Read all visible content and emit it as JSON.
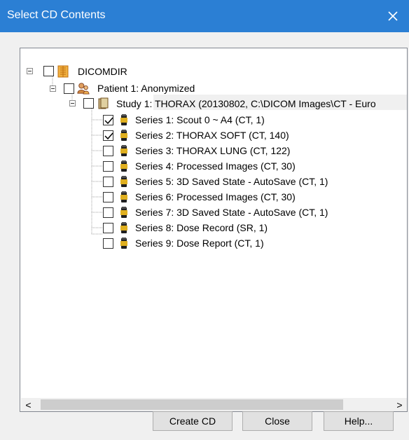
{
  "window": {
    "title": "Select CD Contents",
    "close_icon": "close-icon"
  },
  "tree": {
    "root": {
      "label": "DICOMDIR",
      "icon": "dicomdir-book-icon",
      "checked": false,
      "expanded": true
    },
    "patient": {
      "label": "Patient 1: Anonymized",
      "icon": "patient-icon",
      "checked": false,
      "expanded": true
    },
    "study": {
      "label": "Study 1: THORAX (20130802, C:\\DICOM Images\\CT - Euro",
      "icon": "study-icon",
      "checked": false,
      "expanded": true
    },
    "series": [
      {
        "label": "Series 1: Scout  0 ~ A4 (CT, 1)",
        "checked": true,
        "selected": true
      },
      {
        "label": "Series 2: THORAX SOFT (CT, 140)",
        "checked": true,
        "selected": false
      },
      {
        "label": "Series 3: THORAX LUNG (CT, 122)",
        "checked": false,
        "selected": false
      },
      {
        "label": "Series 4: Processed Images (CT, 30)",
        "checked": false,
        "selected": false
      },
      {
        "label": "Series 5: 3D Saved State - AutoSave (CT, 1)",
        "checked": false,
        "selected": false
      },
      {
        "label": "Series 6: Processed Images (CT, 30)",
        "checked": false,
        "selected": false
      },
      {
        "label": "Series 7: 3D Saved State - AutoSave (CT, 1)",
        "checked": false,
        "selected": false
      },
      {
        "label": "Series 8: Dose Record (SR, 1)",
        "checked": false,
        "selected": false
      },
      {
        "label": "Series 9: Dose Report (CT, 1)",
        "checked": false,
        "selected": false
      }
    ]
  },
  "scrollbar": {
    "left_arrow": "<",
    "right_arrow": ">"
  },
  "buttons": {
    "create_cd": "Create CD",
    "close": "Close",
    "help": "Help..."
  },
  "colors": {
    "titlebar": "#2b7fd4",
    "selection": "#f0f0f0"
  }
}
